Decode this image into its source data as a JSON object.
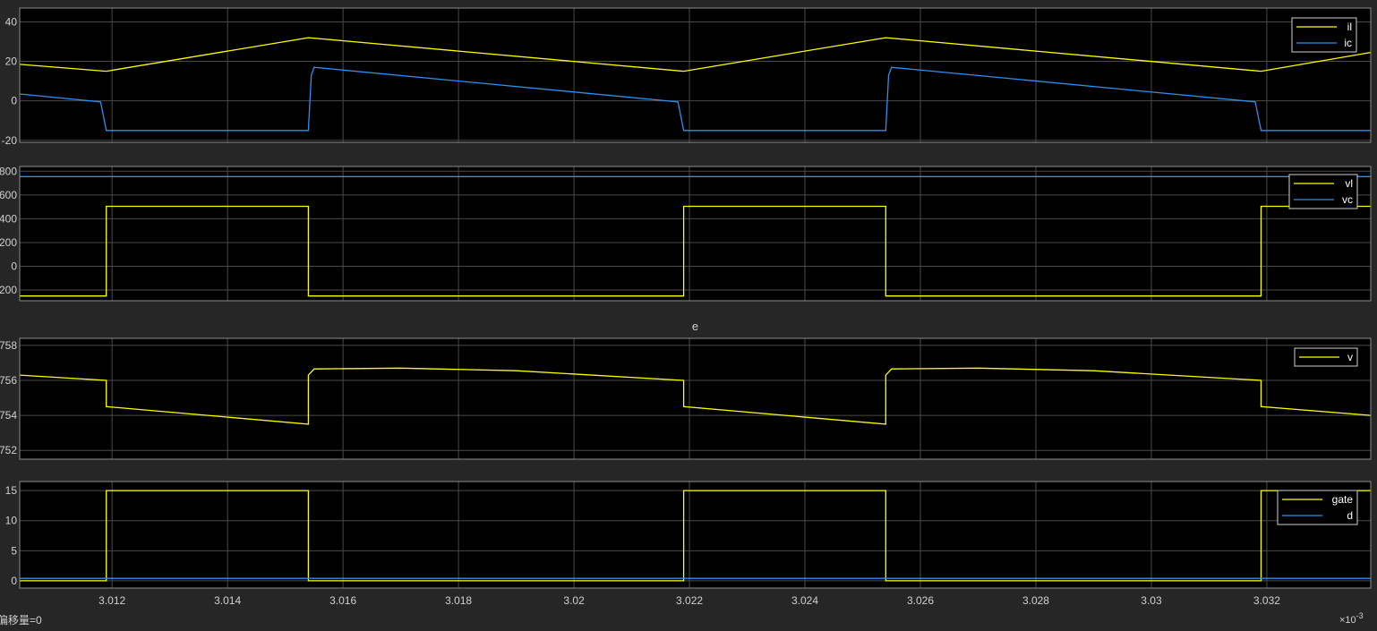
{
  "colors": {
    "background": "#262626",
    "axes_bg": "#000000",
    "axes_border": "#8c8c8c",
    "grid": "#4a4a4a",
    "tick_text": "#d0d0d0",
    "yellow": "#ffff00",
    "blue": "#2d8ff0",
    "legend_bg": "#000000",
    "legend_border": "#d0d0d0"
  },
  "status": {
    "offset_label": "偏移量=0",
    "x_exponent_base": "×10",
    "x_exponent_power": "-3"
  },
  "chart_data": [
    {
      "type": "line",
      "title": "",
      "xlim": [
        3.0104,
        3.0338
      ],
      "ylim": [
        -21,
        47
      ],
      "yticks": [
        -20,
        0,
        20,
        40
      ],
      "ytick_labels": [
        "-20",
        "0",
        "20",
        "40"
      ],
      "grid": true,
      "legend_position": "top-right",
      "series": [
        {
          "name": "il",
          "color": "yellow",
          "x": [
            3.0104,
            3.0119,
            3.0154,
            3.0219,
            3.0254,
            3.0319,
            3.0338
          ],
          "y": [
            18.5,
            15,
            32,
            15,
            32,
            15,
            24.5
          ]
        },
        {
          "name": "ic",
          "color": "blue",
          "x": [
            3.0104,
            3.0118,
            3.0119,
            3.0154,
            3.01545,
            3.0155,
            3.0218,
            3.0219,
            3.0254,
            3.02545,
            3.0255,
            3.0318,
            3.0319,
            3.0338
          ],
          "y": [
            3.5,
            -0.5,
            -15,
            -15,
            13,
            17,
            -0.5,
            -15,
            -15,
            13,
            17,
            -0.5,
            -15,
            -15
          ]
        }
      ]
    },
    {
      "type": "line",
      "title": "",
      "xlim": [
        3.0104,
        3.0338
      ],
      "ylim": [
        -290,
        840
      ],
      "yticks": [
        -200,
        0,
        200,
        400,
        600,
        800
      ],
      "ytick_labels": [
        "-200",
        "0",
        "200",
        "400",
        "600",
        "800"
      ],
      "grid": true,
      "legend_position": "top-right",
      "series": [
        {
          "name": "vl",
          "color": "yellow",
          "x": [
            3.0104,
            3.0119,
            3.0119,
            3.0154,
            3.0154,
            3.0219,
            3.0219,
            3.0254,
            3.0254,
            3.0319,
            3.0319,
            3.0338
          ],
          "y": [
            -250,
            -250,
            505,
            505,
            -250,
            -250,
            505,
            505,
            -250,
            -250,
            505,
            505
          ]
        },
        {
          "name": "vc",
          "color": "blue",
          "x": [
            3.0104,
            3.0338
          ],
          "y": [
            755,
            755
          ]
        }
      ]
    },
    {
      "type": "line",
      "title": "e",
      "xlim": [
        3.0104,
        3.0338
      ],
      "ylim": [
        751.5,
        758.4
      ],
      "yticks": [
        752,
        754,
        756,
        758
      ],
      "ytick_labels": [
        "752",
        "754",
        "756",
        "758"
      ],
      "grid": true,
      "legend_position": "top-right",
      "series": [
        {
          "name": "v",
          "color": "yellow",
          "x": [
            3.0104,
            3.0119,
            3.0119,
            3.0154,
            3.0154,
            3.0155,
            3.017,
            3.019,
            3.0219,
            3.0219,
            3.0254,
            3.0254,
            3.0255,
            3.027,
            3.029,
            3.0319,
            3.0319,
            3.0338
          ],
          "y": [
            756.3,
            756.0,
            754.5,
            753.5,
            756.3,
            756.65,
            756.7,
            756.55,
            756.0,
            754.5,
            753.5,
            756.3,
            756.65,
            756.7,
            756.55,
            756.0,
            754.5,
            754.0
          ]
        }
      ]
    },
    {
      "type": "line",
      "title": "",
      "xlim": [
        3.0104,
        3.0338
      ],
      "ylim": [
        -1.2,
        16.5
      ],
      "yticks": [
        0,
        5,
        10,
        15
      ],
      "ytick_labels": [
        "0",
        "5",
        "10",
        "15"
      ],
      "xticks": [
        3.012,
        3.014,
        3.016,
        3.018,
        3.02,
        3.022,
        3.024,
        3.026,
        3.028,
        3.03,
        3.032
      ],
      "xtick_labels": [
        "3.012",
        "3.014",
        "3.016",
        "3.018",
        "3.02",
        "3.022",
        "3.024",
        "3.026",
        "3.028",
        "3.03",
        "3.032"
      ],
      "grid": true,
      "legend_position": "top-right",
      "series": [
        {
          "name": "gate",
          "color": "yellow",
          "x": [
            3.0104,
            3.0119,
            3.0119,
            3.0154,
            3.0154,
            3.0219,
            3.0219,
            3.0254,
            3.0254,
            3.0319,
            3.0319,
            3.0338
          ],
          "y": [
            0,
            0,
            15,
            15,
            0,
            0,
            15,
            15,
            0,
            0,
            15,
            15
          ]
        },
        {
          "name": "d",
          "color": "blue",
          "x": [
            3.0104,
            3.0338
          ],
          "y": [
            0.4,
            0.4
          ]
        }
      ]
    }
  ]
}
